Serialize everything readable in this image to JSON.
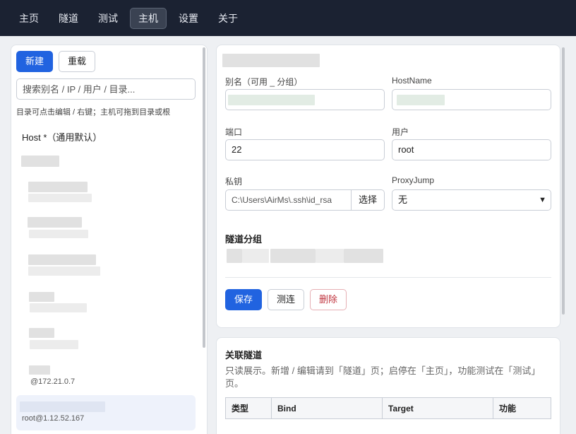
{
  "nav": {
    "tabs": [
      {
        "label": "主页",
        "active": false
      },
      {
        "label": "隧道",
        "active": false
      },
      {
        "label": "测试",
        "active": false
      },
      {
        "label": "主机",
        "active": true
      },
      {
        "label": "设置",
        "active": false
      },
      {
        "label": "关于",
        "active": false
      }
    ]
  },
  "sidebar": {
    "new_label": "新建",
    "reload_label": "重载",
    "search_placeholder": "搜索别名 / IP / 用户 / 目录...",
    "hint": "目录可点击编辑 / 右键；主机可拖到目录或根",
    "host_default": "Host *（通用默认）",
    "item_sub_1": "@172.21.0.7",
    "item_sub_2": "root@1.12.52.167"
  },
  "form": {
    "alias_label": "别名（可用 _ 分组）",
    "hostname_label": "HostName",
    "port_label": "端口",
    "port_value": "22",
    "user_label": "用户",
    "user_value": "root",
    "key_label": "私钥",
    "key_value": "C:\\Users\\AirMs\\.ssh\\id_rsa",
    "key_choose": "选择",
    "proxyjump_label": "ProxyJump",
    "proxyjump_value": "无",
    "tunnel_group_title": "隧道分组",
    "save_label": "保存",
    "test_label": "测连",
    "delete_label": "删除"
  },
  "related": {
    "title": "关联隧道",
    "desc": "只读展示。新增 / 编辑请到「隧道」页；启停在「主页」，功能测试在「测试」页。",
    "columns": [
      "类型",
      "Bind",
      "Target",
      "功能"
    ]
  },
  "colors": {
    "topbar": "#1b2232",
    "primary": "#2163e0",
    "danger": "#c0353f"
  }
}
